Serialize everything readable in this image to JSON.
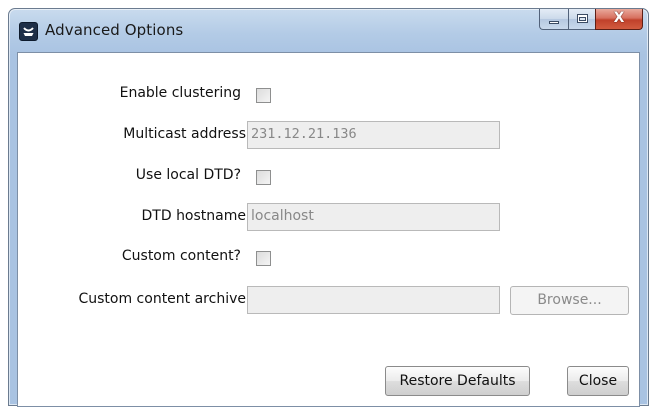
{
  "window": {
    "title": "Advanced Options",
    "app_icon": "app-logo-icon",
    "controls": {
      "minimize_icon": "minimize-icon",
      "maximize_icon": "maximize-icon",
      "close_icon": "close-icon",
      "close_glyph": "X"
    }
  },
  "form": {
    "enable_clustering": {
      "label": "Enable clustering",
      "checked": false
    },
    "multicast_address": {
      "label": "Multicast address",
      "value": "231.12.21.136",
      "enabled": false
    },
    "use_local_dtd": {
      "label": "Use local DTD?",
      "checked": false
    },
    "dtd_hostname": {
      "label": "DTD hostname",
      "value": "localhost",
      "enabled": false
    },
    "custom_content": {
      "label": "Custom content?",
      "checked": false
    },
    "custom_content_archive": {
      "label": "Custom content archive",
      "value": "",
      "enabled": false
    },
    "browse_button": {
      "label": "Browse...",
      "enabled": false
    }
  },
  "footer": {
    "restore_defaults_label": "Restore Defaults",
    "close_label": "Close"
  },
  "colors": {
    "titlebar": "#b3cbe6",
    "close_button": "#c0412b",
    "disabled_field": "#eeeeee"
  }
}
